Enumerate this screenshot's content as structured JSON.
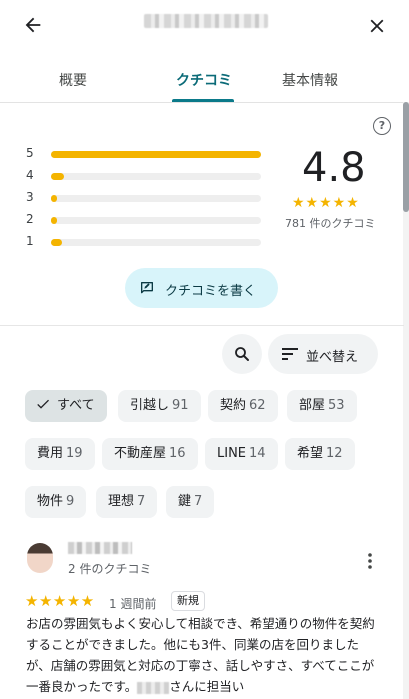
{
  "header": {
    "back_icon": "arrow-left-icon",
    "close_icon": "close-icon"
  },
  "tabs": [
    {
      "label": "概要"
    },
    {
      "label": "クチコミ"
    },
    {
      "label": "基本情報"
    }
  ],
  "summary": {
    "help_icon": "?",
    "bars": [
      {
        "label": "5",
        "fraction": 1.0
      },
      {
        "label": "4",
        "fraction": 0.06
      },
      {
        "label": "3",
        "fraction": 0.015
      },
      {
        "label": "2",
        "fraction": 0.015
      },
      {
        "label": "1",
        "fraction": 0.05
      }
    ],
    "rating": "4.8",
    "stars": "★★★★★",
    "review_count": "781 件のクチコミ",
    "write_label": "クチコミを書く"
  },
  "toolbar": {
    "sort_label": "並べ替え"
  },
  "chips": [
    {
      "label": "すべて",
      "count": ""
    },
    {
      "label": "引越し",
      "count": "91"
    },
    {
      "label": "契約",
      "count": "62"
    },
    {
      "label": "部屋",
      "count": "53"
    },
    {
      "label": "費用",
      "count": "19"
    },
    {
      "label": "不動産屋",
      "count": "16"
    },
    {
      "label": "LINE",
      "count": "14"
    },
    {
      "label": "希望",
      "count": "12"
    },
    {
      "label": "物件",
      "count": "9"
    },
    {
      "label": "理想",
      "count": "7"
    },
    {
      "label": "鍵",
      "count": "7"
    }
  ],
  "review": {
    "author_count": "2 件のクチコミ",
    "stars": "★★★★★",
    "date": "1 週間前",
    "badge": "新規",
    "text_1": "お店の雰囲気もよく安心して相談でき、希望通りの物件を契約することができました。他にも3件、同業の店を回りましたが、店舗の雰囲気と対応の丁寧さ、話しやすさ、すべてここが一番良かったです。",
    "text_2": "さんに担当い"
  },
  "colors": {
    "accent": "#0b7a8a",
    "star": "#f4b400",
    "write_bg": "#d8f4fa"
  }
}
